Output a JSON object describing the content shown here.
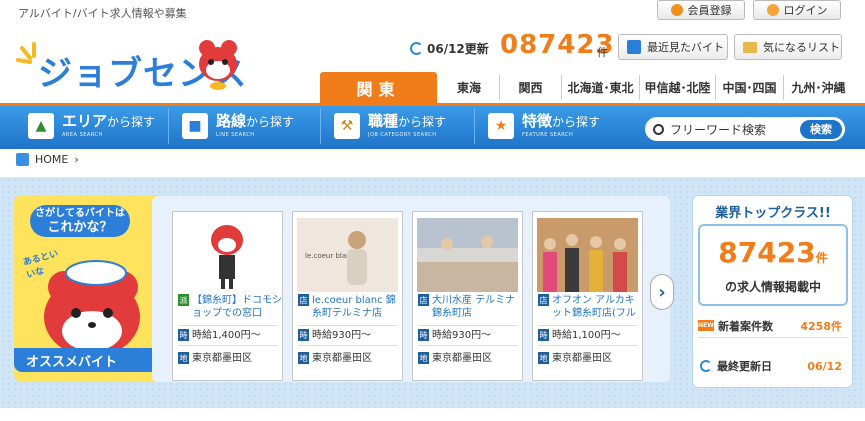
{
  "header": {
    "tagline": "アルバイト/バイト求人情報や募集",
    "register_label": "会員登録",
    "login_label": "ログイン",
    "logo_text": "ジョブセンス",
    "update_date": "06/12更新",
    "job_count": "087423",
    "job_count_unit": "件",
    "recent_label": "最近見たバイト",
    "favorite_label": "気になるリスト"
  },
  "regions": [
    "関東",
    "東海",
    "関西",
    "北海道･東北",
    "甲信越･北陸",
    "中国･四国",
    "九州･沖縄"
  ],
  "nav": [
    {
      "main": "エリア",
      "suffix": "から探す",
      "sub": "AREA SEARCH"
    },
    {
      "main": "路線",
      "suffix": "から探す",
      "sub": "LINE SEARCH"
    },
    {
      "main": "職種",
      "suffix": "から探す",
      "sub": "JOB CATEGORY SEARCH"
    },
    {
      "main": "特徴",
      "suffix": "から探す",
      "sub": "FEATURE SEARCH"
    }
  ],
  "search": {
    "placeholder": "フリーワード検索",
    "button": "検索"
  },
  "breadcrumb": {
    "home": "HOME"
  },
  "promo": {
    "bubble_line1": "さがしてるバイトは",
    "bubble_line2": "これかな？",
    "mini_bubble": "あるといいな",
    "banner": "オススメバイト"
  },
  "cards": [
    {
      "type": "派",
      "title": "【錦糸町】ドコモショップでの窓口",
      "wage_tag": "時",
      "wage": "時給1,400円～",
      "area_tag": "地",
      "area": "東京都墨田区"
    },
    {
      "type": "店",
      "title": "le.coeur blanc 錦糸町テルミナ店",
      "wage_tag": "時",
      "wage": "時給930円～",
      "area_tag": "地",
      "area": "東京都墨田区",
      "img_caption": "le.coeur blanc"
    },
    {
      "type": "店",
      "title": "大川水産 テルミナ錦糸町店",
      "wage_tag": "時",
      "wage": "時給930円～",
      "area_tag": "地",
      "area": "東京都墨田区"
    },
    {
      "type": "店",
      "title": "オフオン アルカキット錦糸町店(フル",
      "wage_tag": "時",
      "wage": "時給1,100円～",
      "area_tag": "地",
      "area": "東京都墨田区"
    }
  ],
  "stats": {
    "headline": "業界トップクラス!!",
    "count": "87423",
    "unit": "件",
    "count_caption": "の求人情報掲載中",
    "new_badge": "NEW",
    "new_label": "新着案件数",
    "new_value": "4258件",
    "last_label": "最終更新日",
    "last_value": "06/12"
  },
  "colors": {
    "brand_blue": "#2b7fd8",
    "accent_orange": "#f07d19",
    "mascot_red": "#e23b3b"
  }
}
